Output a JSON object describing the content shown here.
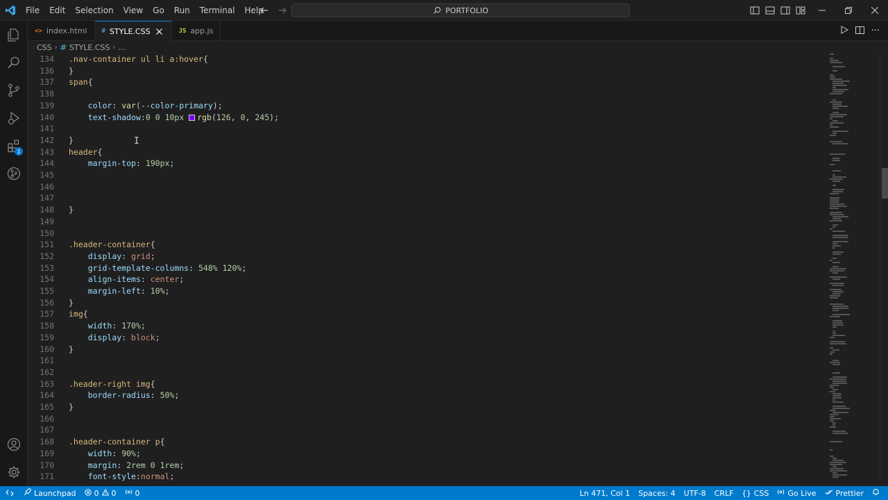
{
  "menu": [
    "File",
    "Edit",
    "Selection",
    "View",
    "Go",
    "Run",
    "Terminal",
    "Help"
  ],
  "search": {
    "label": "PORTFOLIO"
  },
  "tabs": [
    {
      "icon": "<>",
      "label": "index.html",
      "icon_color": "#e37933"
    },
    {
      "icon": "#",
      "label": "STYLE.CSS",
      "icon_color": "#519aba"
    },
    {
      "icon": "JS",
      "label": "app.js",
      "icon_color": "#cbcb41"
    }
  ],
  "breadcrumb": {
    "folder": "CSS",
    "file_icon": "#",
    "file": "STYLE.CSS",
    "more": "..."
  },
  "activity_badge": "1",
  "editor": {
    "lines": [
      {
        "n": "134",
        "text": ".nav-container ul li a:hover{"
      },
      {
        "n": "136",
        "text": "}"
      },
      {
        "n": "137",
        "text": "span{"
      },
      {
        "n": "138",
        "text": ""
      },
      {
        "n": "139",
        "text": "    color: var(--color-primary);"
      },
      {
        "n": "140",
        "text": "    text-shadow:0 0 10px rgb(126, 0, 245);"
      },
      {
        "n": "141",
        "text": ""
      },
      {
        "n": "142",
        "text": "}"
      },
      {
        "n": "143",
        "text": "header{"
      },
      {
        "n": "144",
        "text": "    margin-top: 190px;"
      },
      {
        "n": "145",
        "text": ""
      },
      {
        "n": "146",
        "text": ""
      },
      {
        "n": "147",
        "text": ""
      },
      {
        "n": "148",
        "text": "}"
      },
      {
        "n": "149",
        "text": ""
      },
      {
        "n": "150",
        "text": ""
      },
      {
        "n": "151",
        "text": ".header-container{"
      },
      {
        "n": "152",
        "text": "    display: grid;"
      },
      {
        "n": "153",
        "text": "    grid-template-columns: 548% 120%;"
      },
      {
        "n": "154",
        "text": "    align-items: center;"
      },
      {
        "n": "155",
        "text": "    margin-left: 10%;"
      },
      {
        "n": "156",
        "text": "}"
      },
      {
        "n": "157",
        "text": "img{"
      },
      {
        "n": "158",
        "text": "    width: 170%;"
      },
      {
        "n": "159",
        "text": "    display: block;"
      },
      {
        "n": "160",
        "text": "}"
      },
      {
        "n": "161",
        "text": ""
      },
      {
        "n": "162",
        "text": ""
      },
      {
        "n": "163",
        "text": ".header-right img{"
      },
      {
        "n": "164",
        "text": "    border-radius: 50%;"
      },
      {
        "n": "165",
        "text": "}"
      },
      {
        "n": "166",
        "text": ""
      },
      {
        "n": "167",
        "text": ""
      },
      {
        "n": "168",
        "text": ".header-container p{"
      },
      {
        "n": "169",
        "text": "    width: 90%;"
      },
      {
        "n": "170",
        "text": "    margin: 2rem 0 1rem;"
      },
      {
        "n": "171",
        "text": "    font-style:normal;"
      }
    ],
    "swatch_color": "#7e00f5"
  },
  "statusbar": {
    "launchpad": "Launchpad",
    "errors": "0",
    "warnings": "0",
    "ports": "0",
    "position": "Ln 471, Col 1",
    "spaces": "Spaces: 4",
    "encoding": "UTF-8",
    "eol": "CRLF",
    "language": "CSS",
    "golive": "Go Live",
    "prettier": "Prettier"
  }
}
